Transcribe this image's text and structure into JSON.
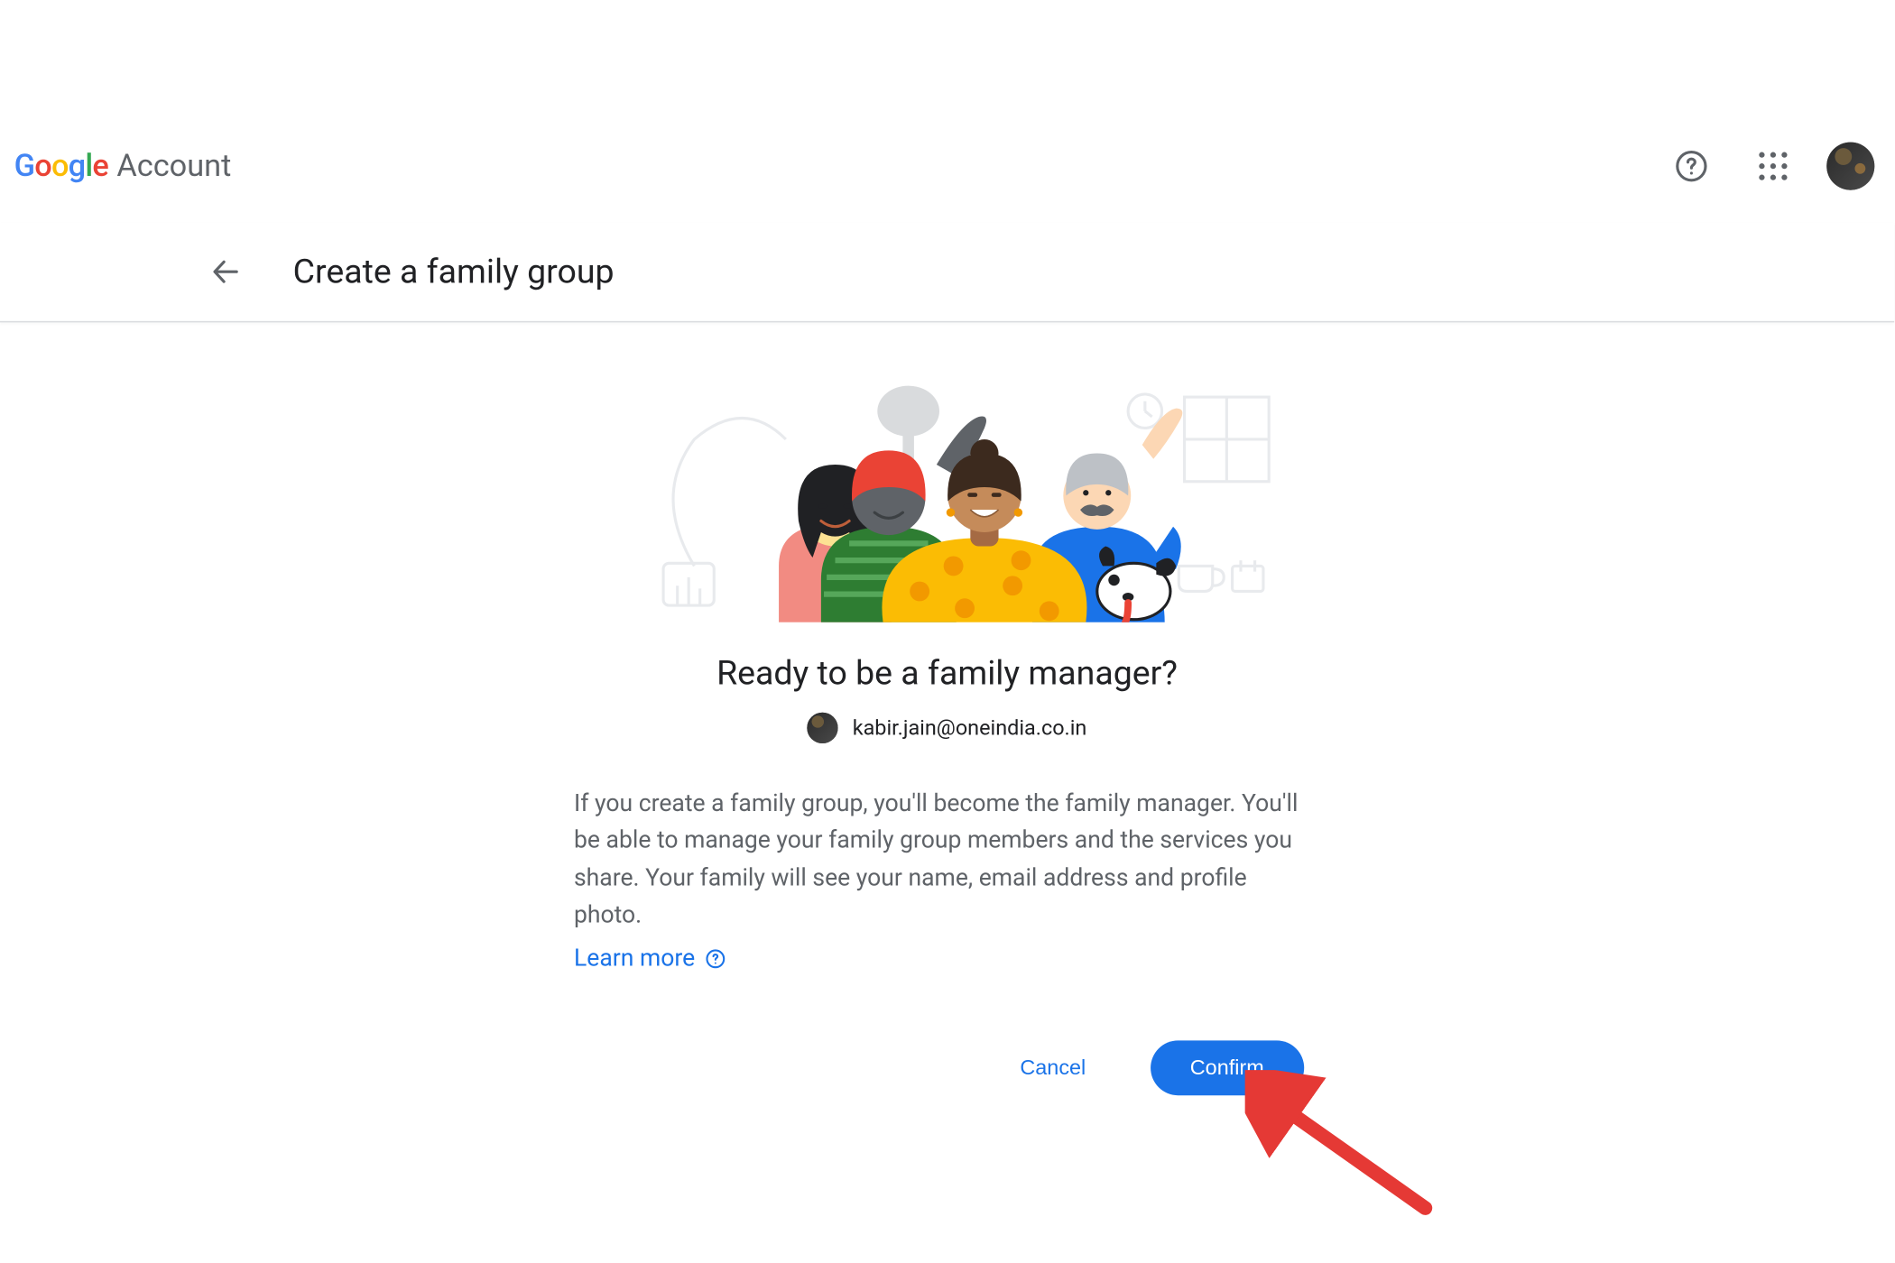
{
  "header": {
    "brand_google": "Google",
    "brand_account": "Account"
  },
  "subheader": {
    "page_title": "Create a family group"
  },
  "content": {
    "headline": "Ready to be a family manager?",
    "user_email": "kabir.jain@oneindia.co.in",
    "body_text": "If you create a family group, you'll become the family manager. You'll be able to manage your family group members and the services you share. Your family will see your name, email address and profile photo.",
    "learn_more_label": "Learn more"
  },
  "actions": {
    "cancel_label": "Cancel",
    "confirm_label": "Confirm"
  },
  "colors": {
    "link": "#1a73e8",
    "button_primary": "#1a73e8",
    "annotation_arrow": "#E53935"
  }
}
